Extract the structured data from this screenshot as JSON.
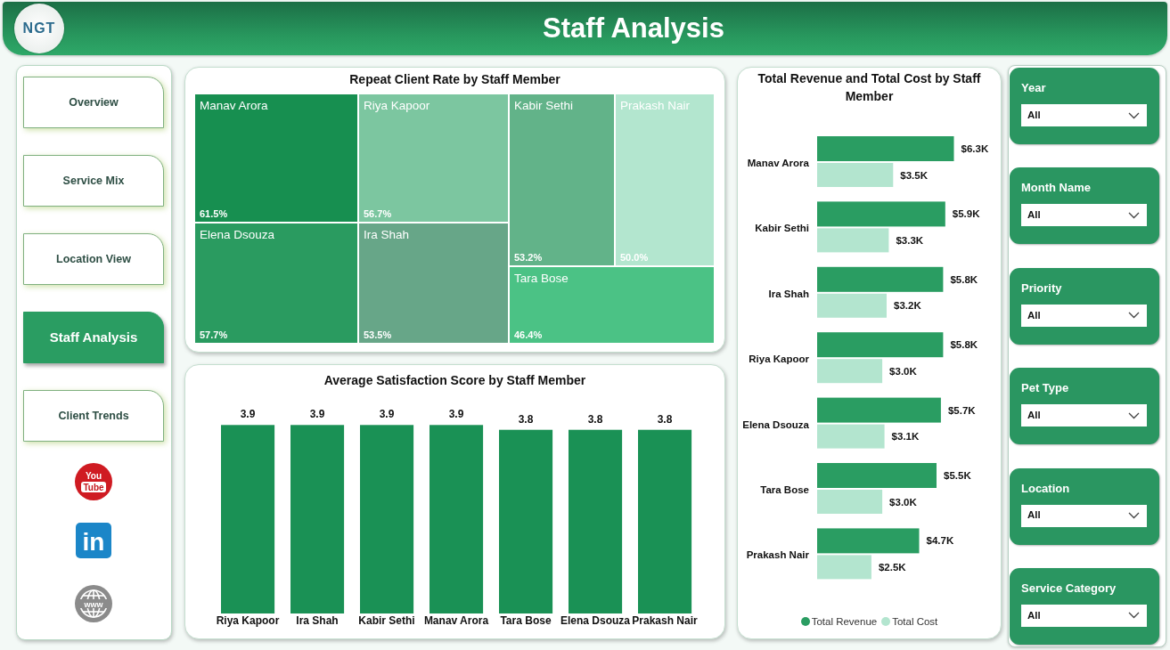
{
  "header": {
    "logo_text": "NGT",
    "title": "Staff Analysis"
  },
  "sidebar": {
    "items": [
      {
        "label": "Overview",
        "selected": false
      },
      {
        "label": "Service Mix",
        "selected": false
      },
      {
        "label": "Location View",
        "selected": false
      },
      {
        "label": "Staff Analysis",
        "selected": true
      },
      {
        "label": "Client Trends",
        "selected": false
      }
    ],
    "links": [
      {
        "kind": "youtube",
        "text": [
          "You",
          "Tube"
        ]
      },
      {
        "kind": "linkedin",
        "text": [
          "in"
        ]
      },
      {
        "kind": "website",
        "text": [
          "www"
        ]
      }
    ]
  },
  "treemap": {
    "title": "Repeat Client Rate by Staff Member",
    "cells": [
      {
        "name": "Manav Arora",
        "rate": "61.5%",
        "color": "#178f50"
      },
      {
        "name": "Riya Kapoor",
        "rate": "56.7%",
        "color": "#7cc6a0"
      },
      {
        "name": "Kabir Sethi",
        "rate": "53.2%",
        "color": "#62b389"
      },
      {
        "name": "Prakash Nair",
        "rate": "50.0%",
        "color": "#b3e6cf"
      },
      {
        "name": "Elena Dsouza",
        "rate": "57.7%",
        "color": "#2a9b60"
      },
      {
        "name": "Ira Shah",
        "rate": "53.5%",
        "color": "#67a688"
      },
      {
        "name": "Tara Bose",
        "rate": "46.4%",
        "color": "#4bc285"
      }
    ]
  },
  "satisfaction_chart": {
    "chart_data": {
      "type": "bar",
      "title": "Average Satisfaction Score by Staff Member",
      "categories": [
        "Riya Kapoor",
        "Ira Shah",
        "Kabir Sethi",
        "Manav Arora",
        "Tara Bose",
        "Elena Dsouza",
        "Prakash Nair"
      ],
      "values": [
        3.9,
        3.9,
        3.9,
        3.9,
        3.8,
        3.8,
        3.8
      ],
      "data_labels": true
    }
  },
  "revenue_chart": {
    "chart_data": {
      "type": "bar",
      "orientation": "horizontal",
      "title": "Total Revenue and Total Cost by Staff Member",
      "categories": [
        "Manav Arora",
        "Kabir Sethi",
        "Ira Shah",
        "Riya Kapoor",
        "Elena Dsouza",
        "Tara Bose",
        "Prakash Nair"
      ],
      "series": [
        {
          "name": "Total Revenue",
          "color": "#2a9d62",
          "values": [
            6300,
            5900,
            5800,
            5800,
            5700,
            5500,
            4700
          ],
          "value_labels": [
            "$6.3K",
            "$5.9K",
            "$5.8K",
            "$5.8K",
            "$5.7K",
            "$5.5K",
            "$4.7K"
          ]
        },
        {
          "name": "Total Cost",
          "color": "#b3e5cf",
          "values": [
            3500,
            3300,
            3200,
            3000,
            3100,
            3000,
            2500
          ],
          "value_labels": [
            "$3.5K",
            "$3.3K",
            "$3.2K",
            "$3.0K",
            "$3.1K",
            "$3.0K",
            "$2.5K"
          ]
        }
      ]
    }
  },
  "filters": [
    {
      "label": "Year",
      "value": "All"
    },
    {
      "label": "Month Name",
      "value": "All"
    },
    {
      "label": "Priority",
      "value": "All"
    },
    {
      "label": "Pet Type",
      "value": "All"
    },
    {
      "label": "Location",
      "value": "All"
    },
    {
      "label": "Service Category",
      "value": "All"
    }
  ]
}
